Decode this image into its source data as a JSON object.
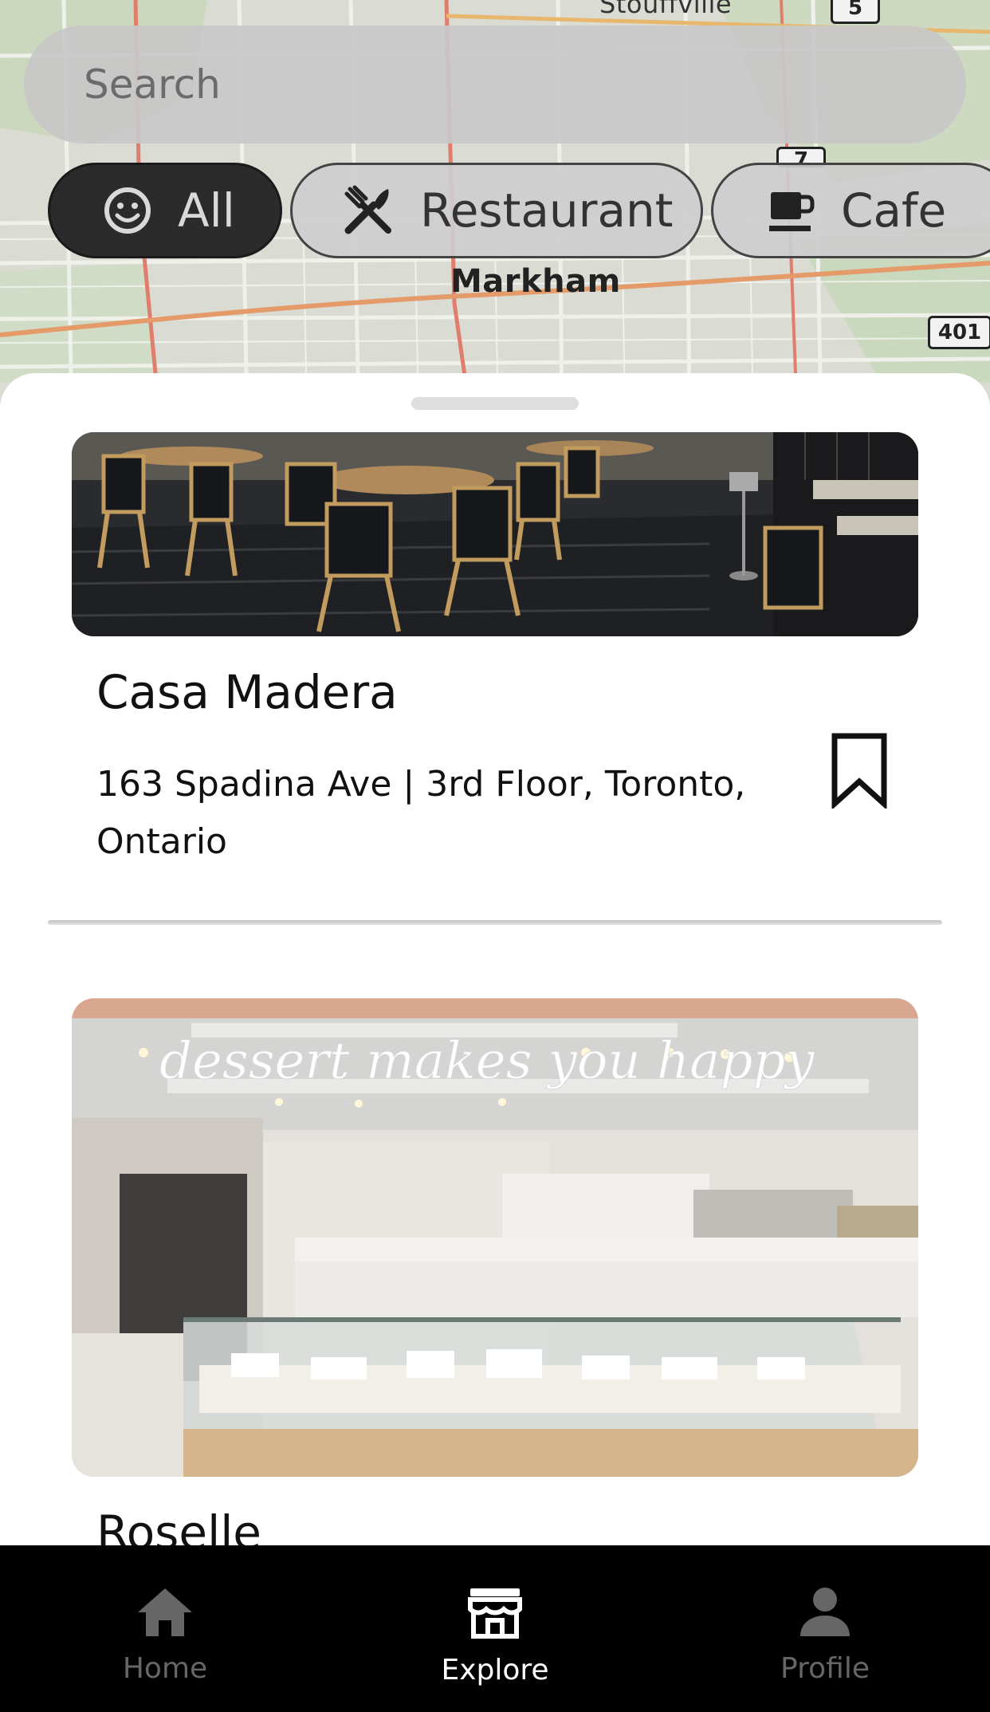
{
  "map": {
    "place_labels": [
      "Stouffville",
      "Markham"
    ],
    "route_shields": [
      "5",
      "7",
      "401"
    ]
  },
  "search": {
    "placeholder": "Search"
  },
  "filters": [
    {
      "label": "All",
      "icon": "smiley-icon",
      "active": true
    },
    {
      "label": "Restaurant",
      "icon": "fork-knife-icon",
      "active": false
    },
    {
      "label": "Cafe",
      "icon": "coffee-cup-icon",
      "active": false
    }
  ],
  "places": [
    {
      "name": "Casa Madera",
      "address": "163 Spadina Ave | 3rd Floor, Toronto, Ontario",
      "bookmarked": false
    },
    {
      "name": "Roselle",
      "sign_text": "dessert makes you happy"
    }
  ],
  "nav": {
    "items": [
      {
        "label": "Home",
        "icon": "home-icon",
        "active": false
      },
      {
        "label": "Explore",
        "icon": "store-icon",
        "active": true
      },
      {
        "label": "Profile",
        "icon": "person-icon",
        "active": false
      }
    ]
  },
  "colors": {
    "active_chip": "#2b2b2b",
    "chip_bg": "#cdcdcd",
    "nav_bg": "#000000",
    "nav_active": "#ffffff",
    "nav_inactive": "#666666"
  }
}
